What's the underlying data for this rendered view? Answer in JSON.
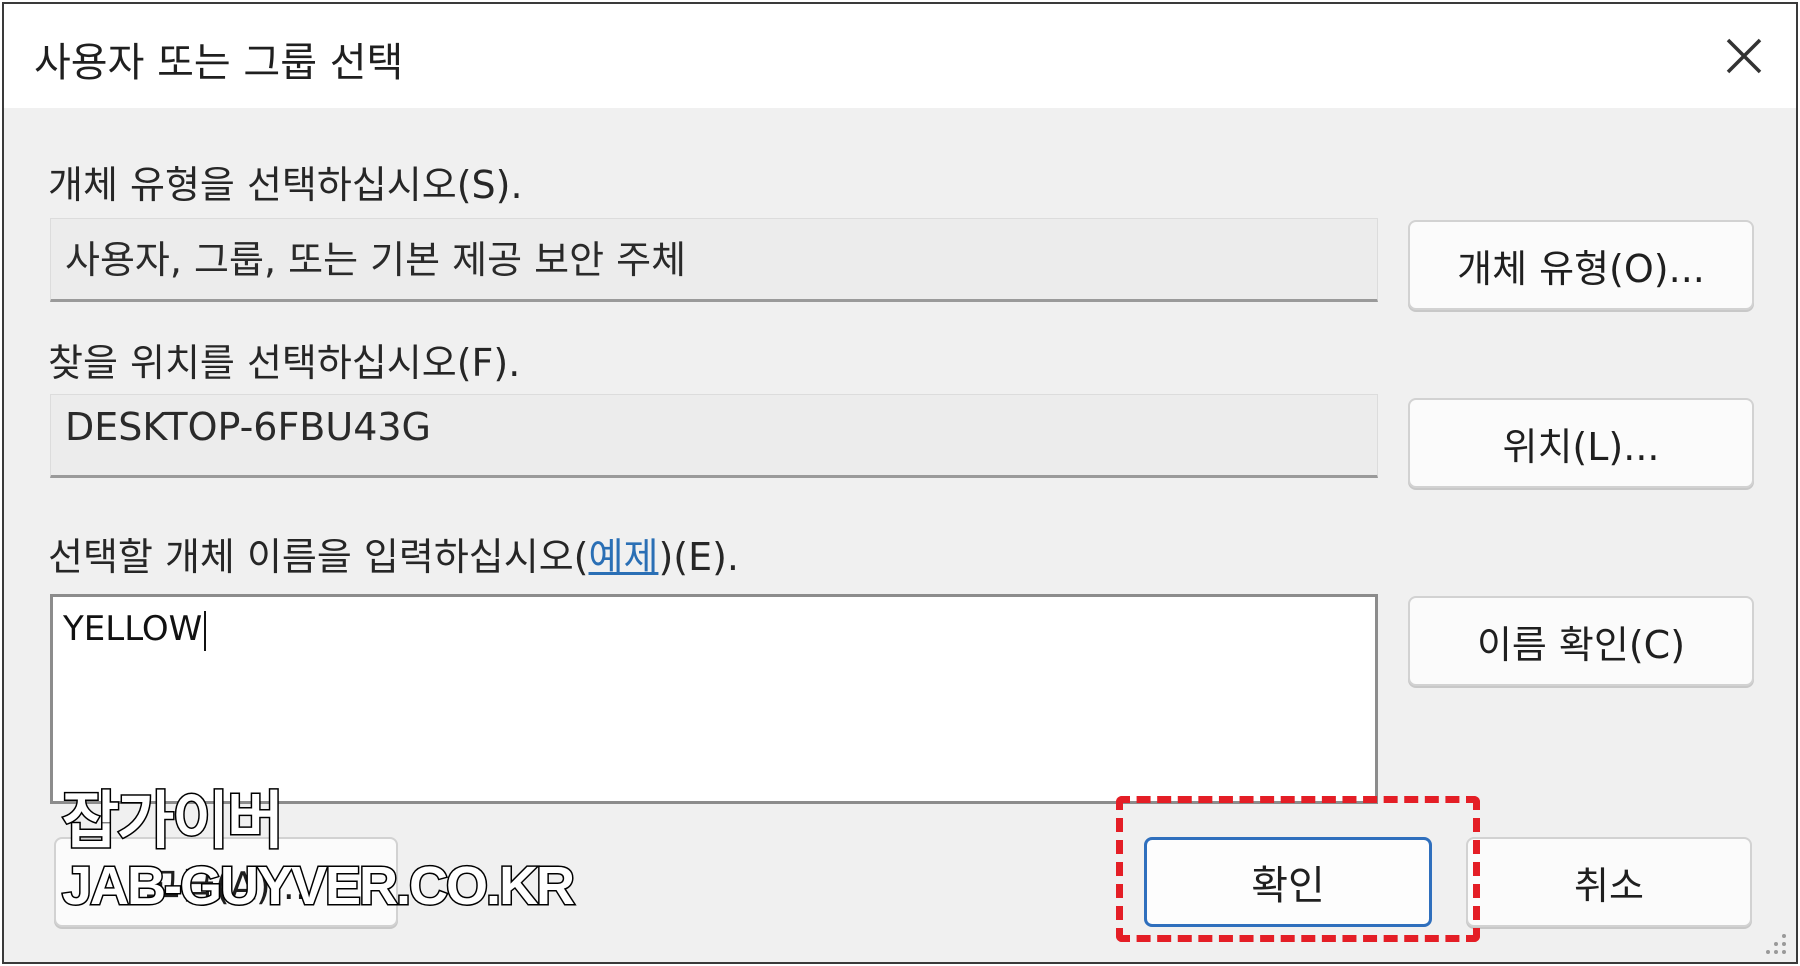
{
  "dialog": {
    "title": "사용자 또는 그룹 선택"
  },
  "object_type": {
    "label": "개체 유형을 선택하십시오(S).",
    "value": "사용자, 그룹, 또는 기본 제공 보안 주체",
    "button_label": "개체 유형(O)..."
  },
  "location": {
    "label": "찾을 위치를 선택하십시오(F).",
    "value": "DESKTOP-6FBU43G",
    "button_label": "위치(L)..."
  },
  "object_names": {
    "label_prefix": "선택할 개체 이름을 입력하십시오(",
    "label_link": "예제",
    "label_suffix": ")(E).",
    "value": "YELLOW",
    "check_names_label": "이름 확인(C)"
  },
  "footer": {
    "advanced_label": "고급(A)...",
    "ok_label": "확인",
    "cancel_label": "취소"
  },
  "watermark": {
    "title": "잡가이버",
    "url": "JAB-GUYVER.CO.KR"
  },
  "colors": {
    "highlight": "#e41e26",
    "ok_border": "#2f6fbd",
    "link": "#2a6fb5"
  },
  "icons": [
    "close-icon",
    "resize-grip-icon"
  ]
}
